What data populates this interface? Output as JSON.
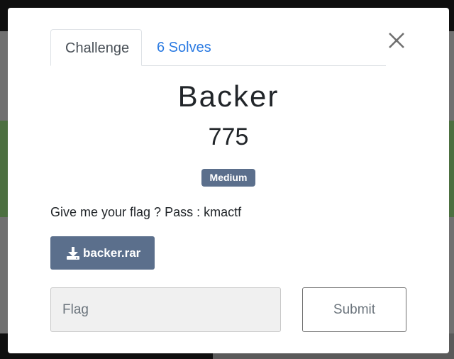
{
  "modal": {
    "tabs": [
      {
        "label": "Challenge",
        "active": true
      },
      {
        "label": "6 Solves",
        "active": false
      }
    ],
    "close_icon": "close-icon",
    "challenge": {
      "name": "Backer",
      "points": "775",
      "difficulty": "Medium",
      "description": "Give me your flag ? Pass : kmactf",
      "file": {
        "label": "backer.rar",
        "icon": "download-icon"
      }
    },
    "submission": {
      "placeholder": "Flag",
      "value": "",
      "submit_label": "Submit"
    }
  },
  "colors": {
    "accent_link": "#2a7ae2",
    "badge": "#5b6f8c",
    "button": "#5b6f8c"
  }
}
